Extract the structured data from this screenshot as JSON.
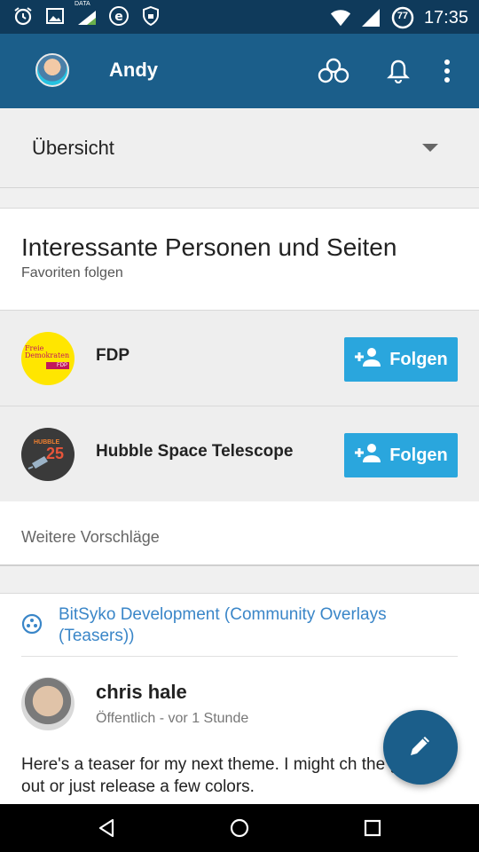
{
  "status_bar": {
    "time": "17:35",
    "battery_level": "77",
    "data_label": "DATA",
    "icons": [
      "alarm-icon",
      "image-icon",
      "data-signal-icon",
      "e-icon",
      "shield-icon",
      "wifi-icon",
      "cell-signal-icon",
      "battery-icon"
    ]
  },
  "app_bar": {
    "user_name": "Andy",
    "icons": [
      "circles-icon",
      "notifications-icon",
      "overflow-menu-icon"
    ],
    "color": "#1b5e8a"
  },
  "stream_selector": {
    "selected": "Übersicht"
  },
  "suggestions_card": {
    "title": "Interessante Personen und Seiten",
    "subtitle": "Favoriten folgen",
    "items": [
      {
        "name": "FDP",
        "follow_label": "Folgen",
        "avatar_text": "Freie Demokraten",
        "avatar_badge": "FDP"
      },
      {
        "name": "Hubble Space Telescope",
        "follow_label": "Folgen",
        "avatar_text": "HUBBLE",
        "avatar_badge": "25"
      }
    ],
    "more_link": "Weitere Vorschläge",
    "button_color": "#2aa6dd"
  },
  "post": {
    "community": "BitSyko Development (Community Overlays (Teasers))",
    "author": "chris hale",
    "meta": "Öffentlich - vor 1 Stunde",
    "text": "Here's a teaser for my next theme.  I might ch the green out or just release a few colors."
  },
  "fab": {
    "icon": "pencil-icon"
  },
  "nav_bar": {
    "icons": [
      "back-icon",
      "home-icon",
      "recents-icon"
    ]
  }
}
